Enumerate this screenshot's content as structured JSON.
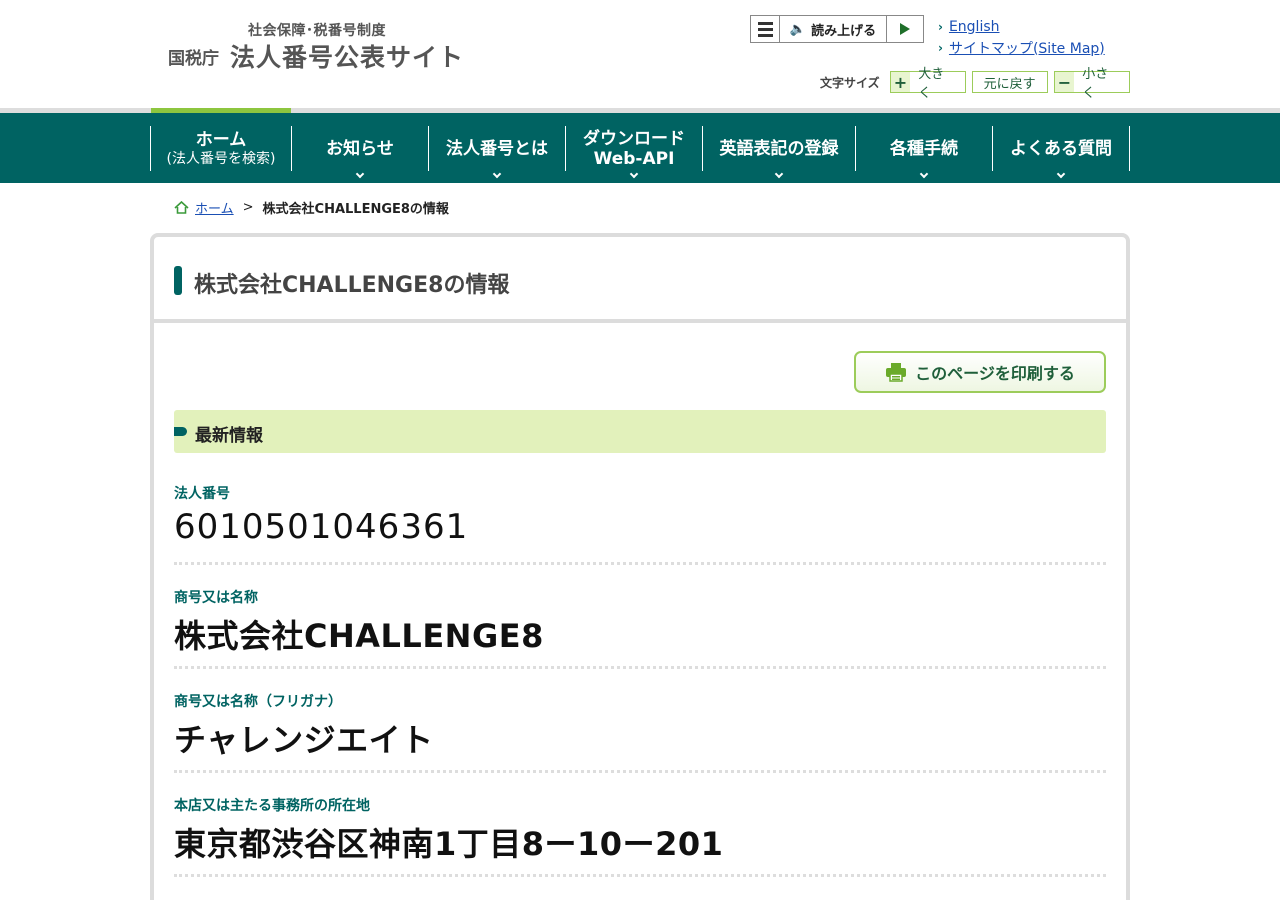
{
  "header": {
    "logo_sub": "社会保障･税番号制度",
    "logo_agency": "国税庁",
    "logo_title": "法人番号公表サイト",
    "read_aloud_label": "読み上げる",
    "links": [
      {
        "label": "English"
      },
      {
        "label": "サイトマップ(Site Map)"
      }
    ],
    "font_size": {
      "label": "文字サイズ",
      "bigger": "大きく",
      "reset": "元に戻す",
      "smaller": "小さく"
    }
  },
  "nav": {
    "items": [
      {
        "label": "ホーム",
        "sub": "(法人番号を検索)"
      },
      {
        "label": "お知らせ"
      },
      {
        "label": "法人番号とは"
      },
      {
        "label": "ダウンロード",
        "sub": "Web-API"
      },
      {
        "label": "英語表記の登録"
      },
      {
        "label": "各種手続"
      },
      {
        "label": "よくある質問"
      }
    ]
  },
  "breadcrumb": {
    "home": "ホーム",
    "separator": ">",
    "current": "株式会社CHALLENGE8の情報"
  },
  "main": {
    "title": "株式会社CHALLENGE8の情報",
    "print_label": "このページを印刷する",
    "section_title": "最新情報",
    "fields": [
      {
        "label": "法人番号",
        "value": "6010501046361"
      },
      {
        "label": "商号又は名称",
        "value": "株式会社CHALLENGE8"
      },
      {
        "label": "商号又は名称（フリガナ）",
        "value": "チャレンジエイト"
      },
      {
        "label": "本店又は主たる事務所の所在地",
        "value": "東京都渋谷区神南1丁目8ー10ー201"
      }
    ]
  },
  "colors": {
    "nav_bg": "#006362",
    "accent_green": "#8dc63f",
    "section_bg": "#e2f1bb",
    "link": "#1a4fb4"
  }
}
